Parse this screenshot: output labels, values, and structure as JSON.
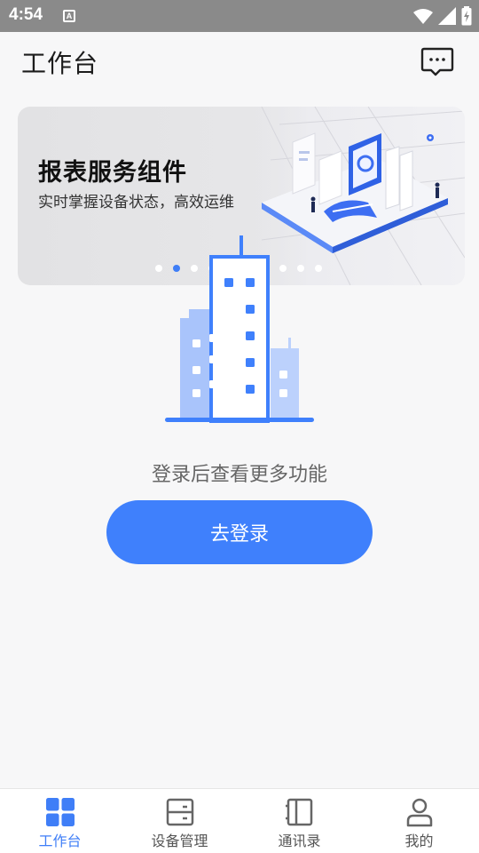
{
  "status_bar": {
    "time": "4:54",
    "badge": "A"
  },
  "header": {
    "title": "工作台",
    "message_icon": "chat-bubble-icon"
  },
  "banner": {
    "title": "报表服务组件",
    "subtitle": "实时掌握设备状态，高效运维",
    "slide_count": 10,
    "active_slide": 2
  },
  "empty_state": {
    "illustration": "building-icon",
    "message": "登录后查看更多功能",
    "login_button": "去登录"
  },
  "nav": {
    "items": [
      {
        "label": "工作台",
        "icon": "grid-icon",
        "active": true
      },
      {
        "label": "设备管理",
        "icon": "device-icon",
        "active": false
      },
      {
        "label": "通讯录",
        "icon": "contacts-icon",
        "active": false
      },
      {
        "label": "我的",
        "icon": "user-icon",
        "active": false
      }
    ]
  },
  "colors": {
    "accent": "#3f80fc",
    "status_bar": "#8a8a8a",
    "background": "#f7f7f8"
  }
}
